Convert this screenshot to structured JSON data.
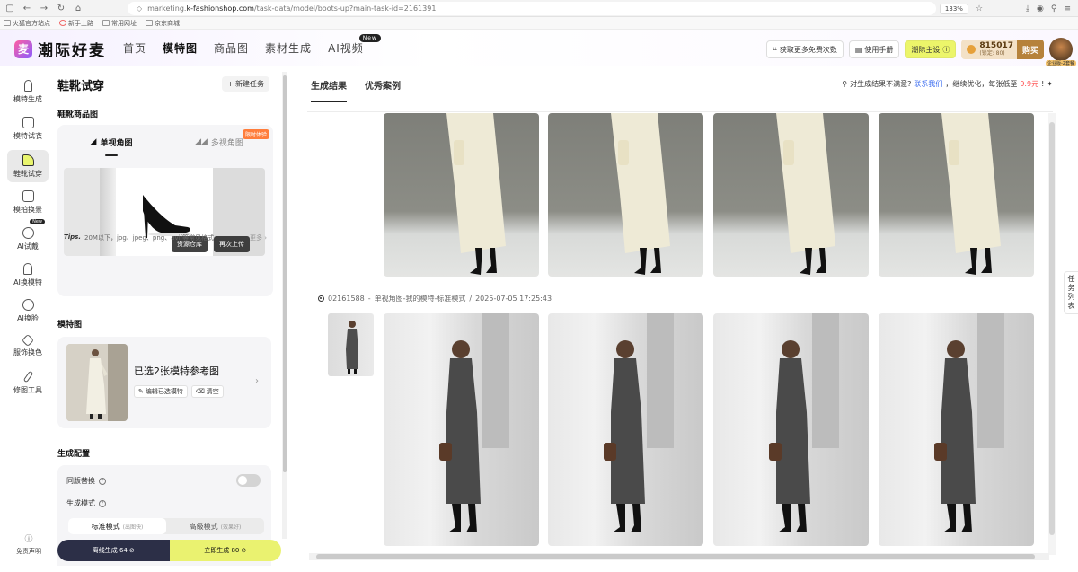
{
  "browser": {
    "url_prefix": "marketing.",
    "url_host": "k-fashionshop.com",
    "url_path": "/task-data/model/boots-up?main-task-id=2161391",
    "zoom": "133%",
    "bookmarks": [
      "火狐官方站点",
      "新手上路",
      "常用网址",
      "京东商城"
    ]
  },
  "app": {
    "logo_text": "潮际好麦",
    "nav": [
      {
        "label": "首页"
      },
      {
        "label": "模特图"
      },
      {
        "label": "商品图"
      },
      {
        "label": "素材生成"
      },
      {
        "label": "AI视频",
        "badge": "New"
      }
    ],
    "header_buttons": {
      "free_count": "获取更多免费次数",
      "manual": "使用手册",
      "theme": "潮际主设"
    },
    "points": {
      "value": "815017",
      "frozen": "(锁定: 80)",
      "buy": "购买"
    },
    "avatar_tag": "企业版-2套餐"
  },
  "sidebar": {
    "items": [
      {
        "label": "模特生成",
        "icon": "model-icon"
      },
      {
        "label": "模特试衣",
        "icon": "tshirt-icon"
      },
      {
        "label": "鞋靴试穿",
        "icon": "shoe-icon"
      },
      {
        "label": "模拍换景",
        "icon": "scene-icon"
      },
      {
        "label": "AI试戴",
        "icon": "accessory-icon",
        "badge": "New"
      },
      {
        "label": "AI换模特",
        "icon": "swap-model-icon"
      },
      {
        "label": "AI换脸",
        "icon": "face-icon"
      },
      {
        "label": "服饰换色",
        "icon": "color-icon"
      },
      {
        "label": "修图工具",
        "icon": "brush-icon"
      }
    ],
    "disclaimer": "免责声明"
  },
  "panel": {
    "title": "鞋靴试穿",
    "new_task": "新建任务",
    "shoe_section": "鞋靴商品图",
    "tab_single": "单视角图",
    "tab_multi": "多视角图",
    "limited": "限时体验",
    "asset_btn": "资源仓库",
    "reupload_btn": "再次上传",
    "tips_label": "Tips.",
    "tips_text": "20M以下，jpg、jpeg、png、avif等常见格式",
    "more": "更多",
    "model_section": "模特图",
    "model_selected": "已选2张模特参考图",
    "edit_btn": "编辑已选模特",
    "clear_btn": "清空",
    "config_section": "生成配置",
    "same_swap": "同版替换",
    "gen_mode": "生成模式",
    "mode_standard": "标准模式",
    "mode_standard_hint": "(出图快)",
    "mode_advanced": "高级模式",
    "mode_advanced_hint": "(效果好)",
    "offline_btn": "离线生成 64",
    "instant_btn": "立即生成 80"
  },
  "main": {
    "tabs": [
      "生成结果",
      "优秀案例"
    ],
    "feedback_prefix": "对生成结果不满意?",
    "feedback_link": "联系我们",
    "feedback_mid": "，继续优化，每张低至",
    "feedback_price": "9.9元",
    "feedback_end": "!",
    "task_id": "02161588",
    "task_desc": "单视角图-我的模特-标准模式",
    "task_time": "2025-07-05 17:25:43",
    "float_list": [
      "任",
      "务",
      "列",
      "表"
    ]
  }
}
